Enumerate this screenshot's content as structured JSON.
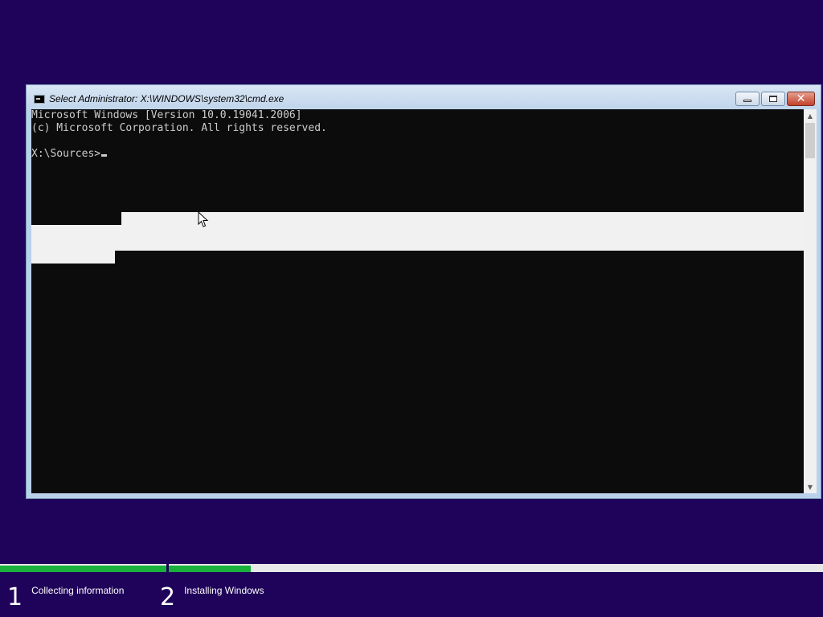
{
  "window": {
    "title": "Select Administrator: X:\\WINDOWS\\system32\\cmd.exe",
    "icon": "cmd-icon"
  },
  "console": {
    "lines": [
      "Microsoft Windows [Version 10.0.19041.2006]",
      "(c) Microsoft Corporation. All rights reserved.",
      "",
      "X:\\Sources>"
    ]
  },
  "scrollbar": {
    "up_icon": "chevron-up-icon",
    "down_icon": "chevron-down-icon",
    "up_glyph": "▲",
    "down_glyph": "▼"
  },
  "close_glyph": "✕",
  "setup": {
    "progress": {
      "step1_fraction": 1.0,
      "step2_fraction": 0.2,
      "color": "#19b03b"
    },
    "steps": [
      {
        "number": "1",
        "label": "Collecting information"
      },
      {
        "number": "2",
        "label": "Installing Windows"
      }
    ]
  },
  "colors": {
    "background": "#1f0259",
    "console_bg": "#0c0c0c",
    "console_text": "#cccccc",
    "selection": "#f1f1f1"
  }
}
